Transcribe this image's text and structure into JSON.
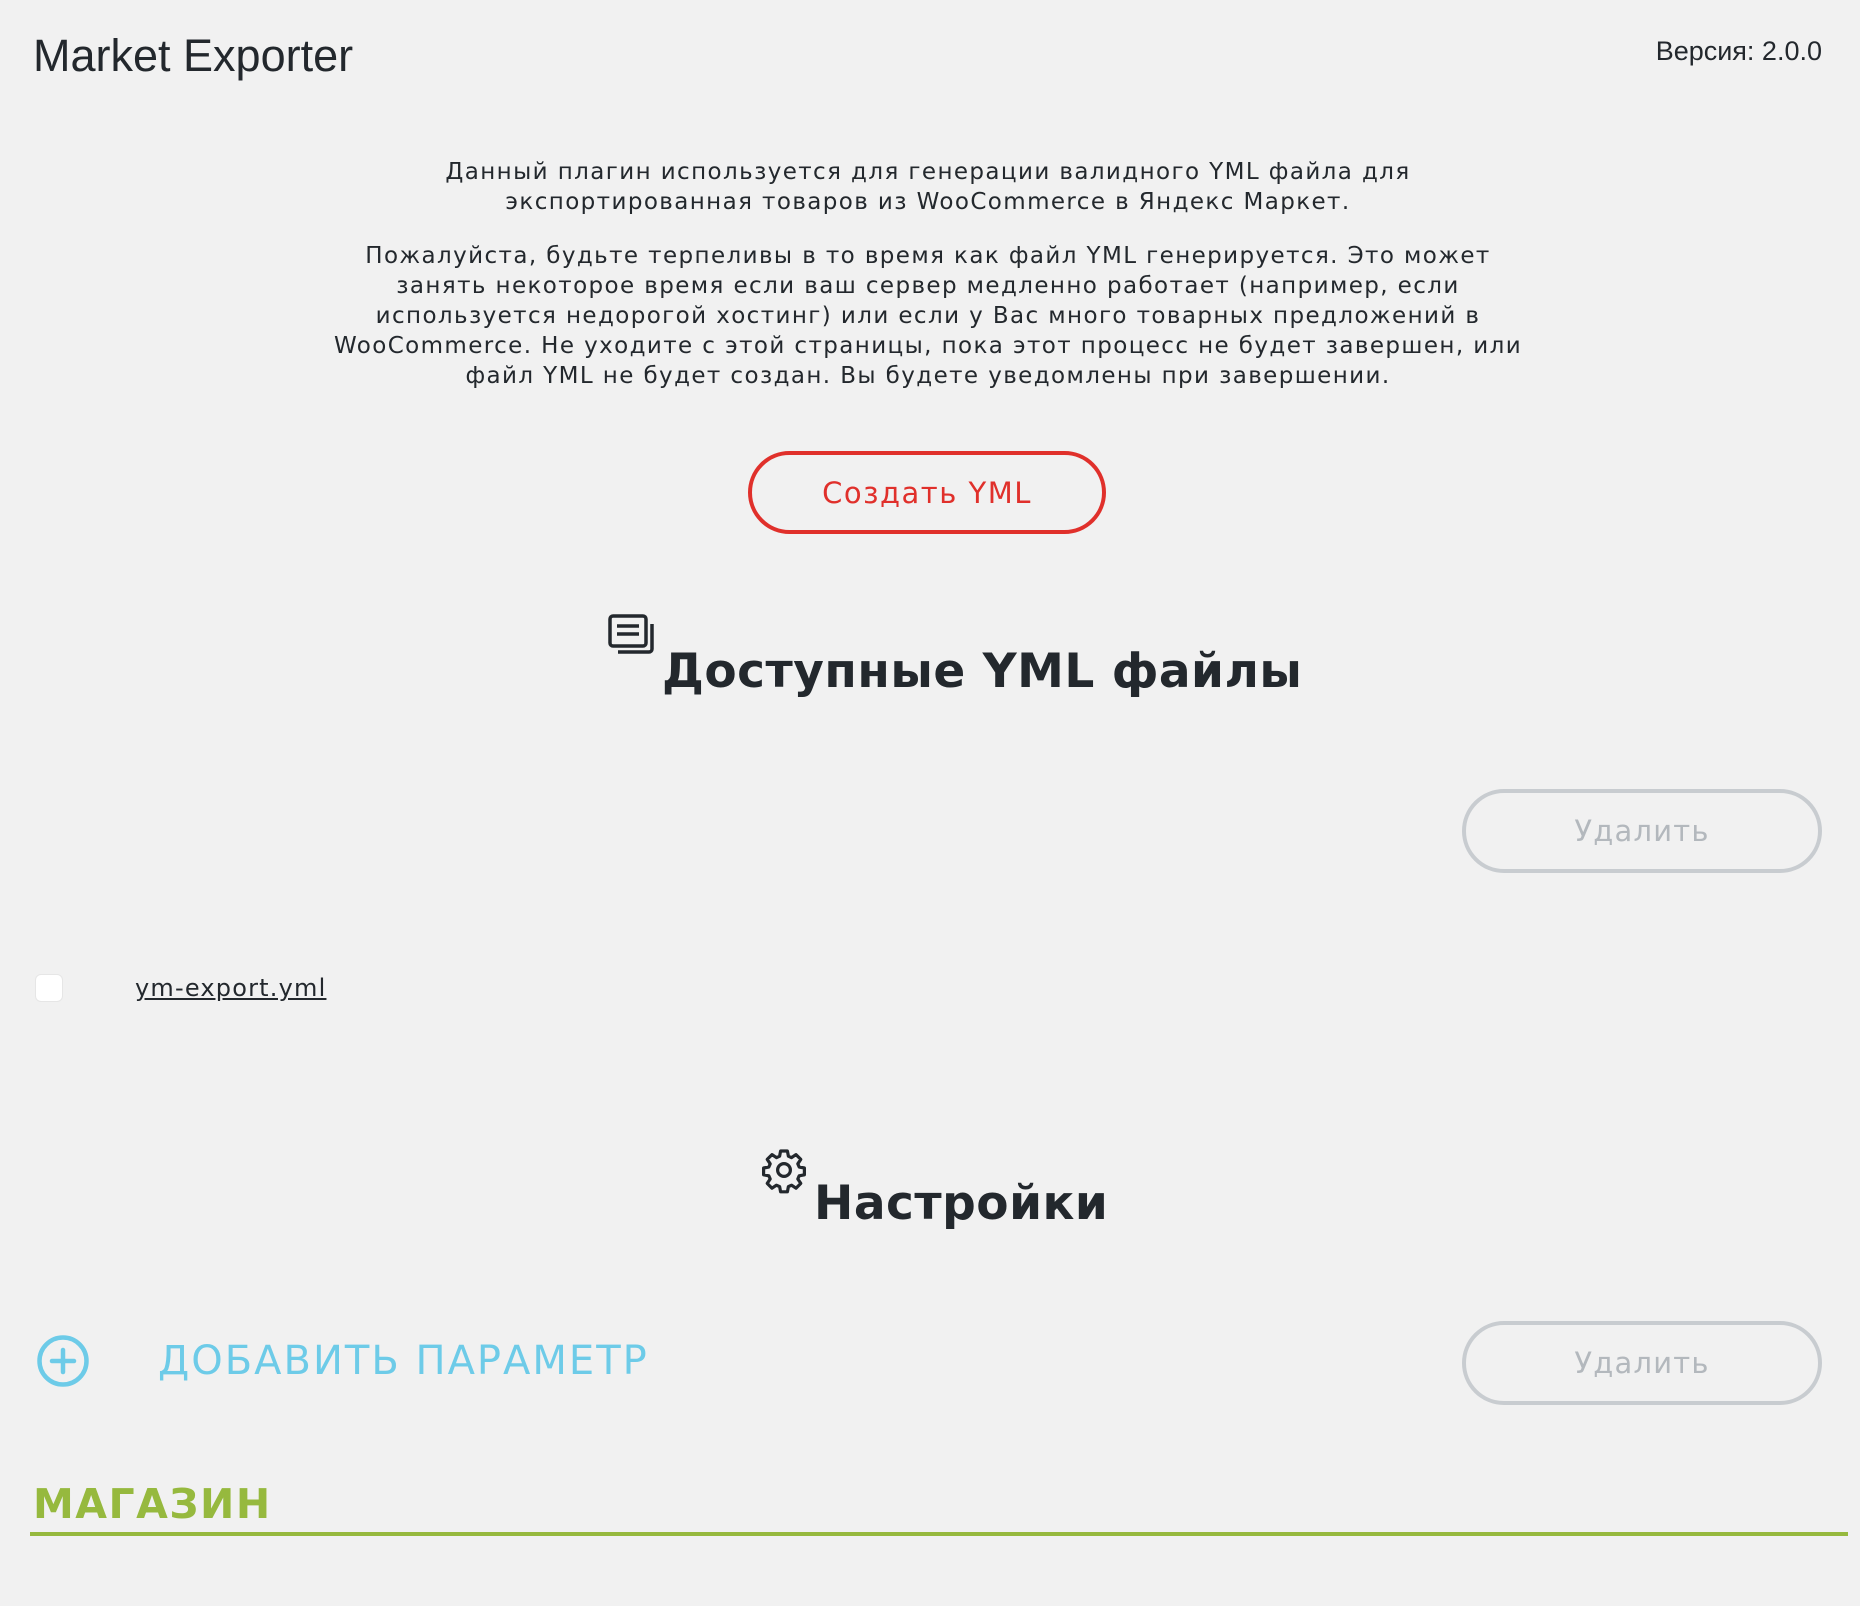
{
  "app": {
    "title": "Market Exporter",
    "version": "Версия: 2.0.0"
  },
  "intro": {
    "paragraph1": "Данный плагин используется для генерации валидного YML файла для экспортированная товаров из WooCommerce в Яндекс Маркет.",
    "paragraph2": "Пожалуйста, будьте терпеливы в то время как файл YML генерируется. Это может занять некоторое время если ваш сервер медленно работает (например, если используется недорогой хостинг) или если у Вас много товарных предложений в WooCommerce. Не уходите с этой страницы, пока этот процесс не будет завершен, или файл YML не будет создан. Вы будете уведомлены при завершении."
  },
  "actions": {
    "create_label": "Создать YML"
  },
  "files_section": {
    "icon": "files-icon",
    "heading": "Доступные YML файлы",
    "delete_label": "Удалить",
    "files": [
      {
        "name": "ym-export.yml",
        "checked": false
      }
    ]
  },
  "settings_section": {
    "icon": "gear-icon",
    "heading": "Настройки",
    "add_param_icon": "plus-circle-icon",
    "add_param_label": "ДОБАВИТЬ ПАРАМЕТР",
    "delete_label": "Удалить",
    "group_label": "МАГАЗИН"
  },
  "colors": {
    "create_accent": "#e0302b",
    "add_param": "#6dcbe8",
    "group_accent": "#96b93e",
    "disabled": "#c8ccd0"
  }
}
